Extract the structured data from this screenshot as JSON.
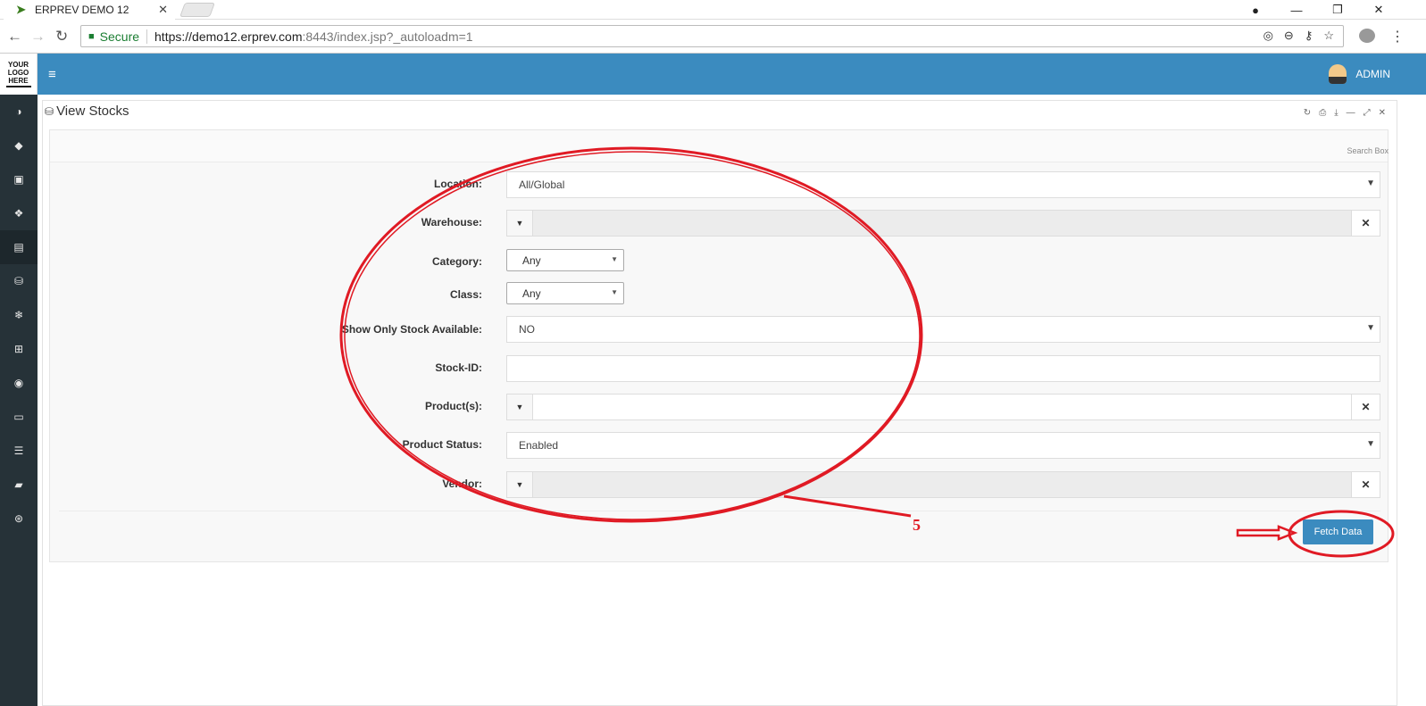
{
  "browser": {
    "tab_title": "ERPREV DEMO 12",
    "tab_close": "✕",
    "secure_label": "Secure",
    "url_host": "https://demo12.erprev.com",
    "url_rest": ":8443/index.jsp?_autoloadm=1"
  },
  "header": {
    "logo_lines": [
      "YOUR",
      "LOGO",
      "HERE"
    ],
    "menu_icon": "≡",
    "user_name": "ADMIN"
  },
  "sidebar": {
    "icons": [
      "dashboard-icon",
      "tag-icon",
      "money-icon",
      "cubes-icon",
      "building-icon",
      "database-bucket-icon",
      "snowflake-icon",
      "cart-icon",
      "disc-icon",
      "monitor-icon",
      "database-icon",
      "book-icon",
      "lifebuoy-icon"
    ],
    "active_index": 4
  },
  "panel": {
    "title": "View Stocks",
    "search_box_label": "Search Box"
  },
  "form": {
    "location": {
      "label": "Location:",
      "value": "All/Global"
    },
    "warehouse": {
      "label": "Warehouse:",
      "value": ""
    },
    "category": {
      "label": "Category:",
      "value": "Any"
    },
    "class": {
      "label": "Class:",
      "value": "Any"
    },
    "show_only_stock": {
      "label": "Show Only Stock Available:",
      "value": "NO"
    },
    "stock_id": {
      "label": "Stock-ID:",
      "value": ""
    },
    "products": {
      "label": "Product(s):",
      "value": ""
    },
    "product_status": {
      "label": "Product Status:",
      "value": "Enabled"
    },
    "vendor": {
      "label": "Vendor:",
      "value": ""
    }
  },
  "actions": {
    "fetch_label": "Fetch Data"
  },
  "annotation": {
    "step_number": "5",
    "color": "#e01a24"
  },
  "colors": {
    "header_blue": "#3b8bbf",
    "sidebar_dark": "#263238"
  }
}
